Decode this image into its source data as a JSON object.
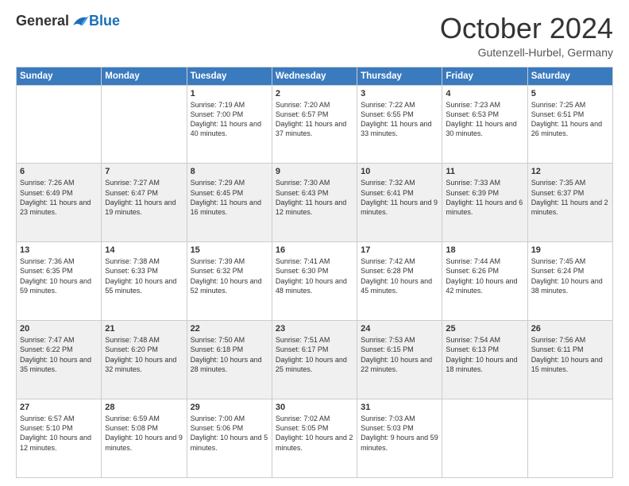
{
  "header": {
    "logo": {
      "general": "General",
      "blue": "Blue"
    },
    "title": "October 2024",
    "location": "Gutenzell-Hurbel, Germany"
  },
  "days_of_week": [
    "Sunday",
    "Monday",
    "Tuesday",
    "Wednesday",
    "Thursday",
    "Friday",
    "Saturday"
  ],
  "weeks": [
    [
      {
        "day": "",
        "content": ""
      },
      {
        "day": "",
        "content": ""
      },
      {
        "day": "1",
        "content": "Sunrise: 7:19 AM\nSunset: 7:00 PM\nDaylight: 11 hours and 40 minutes."
      },
      {
        "day": "2",
        "content": "Sunrise: 7:20 AM\nSunset: 6:57 PM\nDaylight: 11 hours and 37 minutes."
      },
      {
        "day": "3",
        "content": "Sunrise: 7:22 AM\nSunset: 6:55 PM\nDaylight: 11 hours and 33 minutes."
      },
      {
        "day": "4",
        "content": "Sunrise: 7:23 AM\nSunset: 6:53 PM\nDaylight: 11 hours and 30 minutes."
      },
      {
        "day": "5",
        "content": "Sunrise: 7:25 AM\nSunset: 6:51 PM\nDaylight: 11 hours and 26 minutes."
      }
    ],
    [
      {
        "day": "6",
        "content": "Sunrise: 7:26 AM\nSunset: 6:49 PM\nDaylight: 11 hours and 23 minutes."
      },
      {
        "day": "7",
        "content": "Sunrise: 7:27 AM\nSunset: 6:47 PM\nDaylight: 11 hours and 19 minutes."
      },
      {
        "day": "8",
        "content": "Sunrise: 7:29 AM\nSunset: 6:45 PM\nDaylight: 11 hours and 16 minutes."
      },
      {
        "day": "9",
        "content": "Sunrise: 7:30 AM\nSunset: 6:43 PM\nDaylight: 11 hours and 12 minutes."
      },
      {
        "day": "10",
        "content": "Sunrise: 7:32 AM\nSunset: 6:41 PM\nDaylight: 11 hours and 9 minutes."
      },
      {
        "day": "11",
        "content": "Sunrise: 7:33 AM\nSunset: 6:39 PM\nDaylight: 11 hours and 6 minutes."
      },
      {
        "day": "12",
        "content": "Sunrise: 7:35 AM\nSunset: 6:37 PM\nDaylight: 11 hours and 2 minutes."
      }
    ],
    [
      {
        "day": "13",
        "content": "Sunrise: 7:36 AM\nSunset: 6:35 PM\nDaylight: 10 hours and 59 minutes."
      },
      {
        "day": "14",
        "content": "Sunrise: 7:38 AM\nSunset: 6:33 PM\nDaylight: 10 hours and 55 minutes."
      },
      {
        "day": "15",
        "content": "Sunrise: 7:39 AM\nSunset: 6:32 PM\nDaylight: 10 hours and 52 minutes."
      },
      {
        "day": "16",
        "content": "Sunrise: 7:41 AM\nSunset: 6:30 PM\nDaylight: 10 hours and 48 minutes."
      },
      {
        "day": "17",
        "content": "Sunrise: 7:42 AM\nSunset: 6:28 PM\nDaylight: 10 hours and 45 minutes."
      },
      {
        "day": "18",
        "content": "Sunrise: 7:44 AM\nSunset: 6:26 PM\nDaylight: 10 hours and 42 minutes."
      },
      {
        "day": "19",
        "content": "Sunrise: 7:45 AM\nSunset: 6:24 PM\nDaylight: 10 hours and 38 minutes."
      }
    ],
    [
      {
        "day": "20",
        "content": "Sunrise: 7:47 AM\nSunset: 6:22 PM\nDaylight: 10 hours and 35 minutes."
      },
      {
        "day": "21",
        "content": "Sunrise: 7:48 AM\nSunset: 6:20 PM\nDaylight: 10 hours and 32 minutes."
      },
      {
        "day": "22",
        "content": "Sunrise: 7:50 AM\nSunset: 6:18 PM\nDaylight: 10 hours and 28 minutes."
      },
      {
        "day": "23",
        "content": "Sunrise: 7:51 AM\nSunset: 6:17 PM\nDaylight: 10 hours and 25 minutes."
      },
      {
        "day": "24",
        "content": "Sunrise: 7:53 AM\nSunset: 6:15 PM\nDaylight: 10 hours and 22 minutes."
      },
      {
        "day": "25",
        "content": "Sunrise: 7:54 AM\nSunset: 6:13 PM\nDaylight: 10 hours and 18 minutes."
      },
      {
        "day": "26",
        "content": "Sunrise: 7:56 AM\nSunset: 6:11 PM\nDaylight: 10 hours and 15 minutes."
      }
    ],
    [
      {
        "day": "27",
        "content": "Sunrise: 6:57 AM\nSunset: 5:10 PM\nDaylight: 10 hours and 12 minutes."
      },
      {
        "day": "28",
        "content": "Sunrise: 6:59 AM\nSunset: 5:08 PM\nDaylight: 10 hours and 9 minutes."
      },
      {
        "day": "29",
        "content": "Sunrise: 7:00 AM\nSunset: 5:06 PM\nDaylight: 10 hours and 5 minutes."
      },
      {
        "day": "30",
        "content": "Sunrise: 7:02 AM\nSunset: 5:05 PM\nDaylight: 10 hours and 2 minutes."
      },
      {
        "day": "31",
        "content": "Sunrise: 7:03 AM\nSunset: 5:03 PM\nDaylight: 9 hours and 59 minutes."
      },
      {
        "day": "",
        "content": ""
      },
      {
        "day": "",
        "content": ""
      }
    ]
  ]
}
